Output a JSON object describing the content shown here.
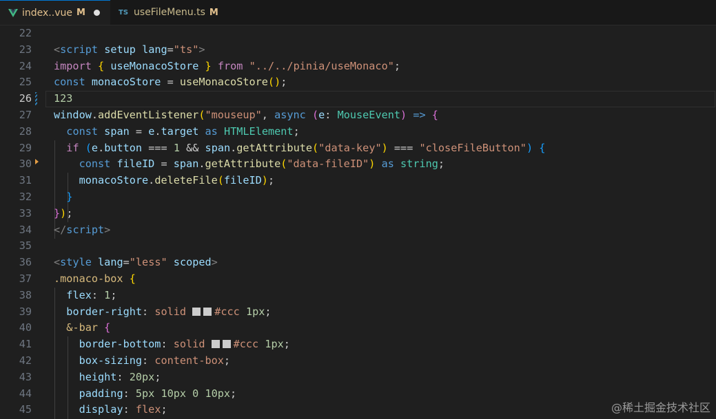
{
  "tabs": [
    {
      "name": "index..vue",
      "status": "M",
      "icon": "vue-icon",
      "dirty": true,
      "active": true
    },
    {
      "name": "useFileMenu.ts",
      "status": "M",
      "icon": "ts-icon",
      "icon_text": "TS",
      "active": false
    }
  ],
  "current_line": 26,
  "lines": [
    {
      "n": "22",
      "tokens": []
    },
    {
      "n": "23",
      "tokens": [
        [
          "tag",
          "<"
        ],
        [
          "tagname",
          "script"
        ],
        [
          "plain",
          " "
        ],
        [
          "attr",
          "setup"
        ],
        [
          "plain",
          " "
        ],
        [
          "attr",
          "lang"
        ],
        [
          "plain",
          "="
        ],
        [
          "str",
          "\"ts\""
        ],
        [
          "tag",
          ">"
        ]
      ]
    },
    {
      "n": "24",
      "tokens": [
        [
          "key",
          "import"
        ],
        [
          "plain",
          " "
        ],
        [
          "br1",
          "{"
        ],
        [
          "plain",
          " "
        ],
        [
          "var",
          "useMonacoStore"
        ],
        [
          "plain",
          " "
        ],
        [
          "br1",
          "}"
        ],
        [
          "plain",
          " "
        ],
        [
          "key",
          "from"
        ],
        [
          "plain",
          " "
        ],
        [
          "str",
          "\"../../pinia/useMonaco\""
        ],
        [
          "plain",
          ";"
        ]
      ]
    },
    {
      "n": "25",
      "tokens": [
        [
          "kw",
          "const"
        ],
        [
          "plain",
          " "
        ],
        [
          "var",
          "monacoStore"
        ],
        [
          "plain",
          " = "
        ],
        [
          "fn",
          "useMonacoStore"
        ],
        [
          "br1",
          "()"
        ],
        [
          "plain",
          ";"
        ]
      ]
    },
    {
      "n": "26",
      "tokens": [
        [
          "num",
          "123"
        ]
      ]
    },
    {
      "n": "27",
      "tokens": [
        [
          "var",
          "window"
        ],
        [
          "plain",
          "."
        ],
        [
          "fn",
          "addEventListener"
        ],
        [
          "br1",
          "("
        ],
        [
          "str",
          "\"mouseup\""
        ],
        [
          "plain",
          ", "
        ],
        [
          "kw",
          "async"
        ],
        [
          "plain",
          " "
        ],
        [
          "br2",
          "("
        ],
        [
          "var",
          "e"
        ],
        [
          "plain",
          ": "
        ],
        [
          "type",
          "MouseEvent"
        ],
        [
          "br2",
          ")"
        ],
        [
          "plain",
          " "
        ],
        [
          "kw",
          "=>"
        ],
        [
          "plain",
          " "
        ],
        [
          "br2",
          "{"
        ]
      ]
    },
    {
      "n": "28",
      "tokens": [
        [
          "plain",
          "  "
        ],
        [
          "kw",
          "const"
        ],
        [
          "plain",
          " "
        ],
        [
          "var",
          "span"
        ],
        [
          "plain",
          " = "
        ],
        [
          "var",
          "e"
        ],
        [
          "plain",
          "."
        ],
        [
          "var",
          "target"
        ],
        [
          "plain",
          " "
        ],
        [
          "kw",
          "as"
        ],
        [
          "plain",
          " "
        ],
        [
          "type",
          "HTMLElement"
        ],
        [
          "plain",
          ";"
        ]
      ]
    },
    {
      "n": "29",
      "tokens": [
        [
          "plain",
          "  "
        ],
        [
          "key",
          "if"
        ],
        [
          "plain",
          " "
        ],
        [
          "br3",
          "("
        ],
        [
          "var",
          "e"
        ],
        [
          "plain",
          "."
        ],
        [
          "var",
          "button"
        ],
        [
          "plain",
          " === "
        ],
        [
          "num",
          "1"
        ],
        [
          "plain",
          " && "
        ],
        [
          "var",
          "span"
        ],
        [
          "plain",
          "."
        ],
        [
          "fn",
          "getAttribute"
        ],
        [
          "br1",
          "("
        ],
        [
          "str",
          "\"data-key\""
        ],
        [
          "br1",
          ")"
        ],
        [
          "plain",
          " === "
        ],
        [
          "str",
          "\"closeFileButton\""
        ],
        [
          "br3",
          ")"
        ],
        [
          "plain",
          " "
        ],
        [
          "br3",
          "{"
        ]
      ]
    },
    {
      "n": "30",
      "tokens": [
        [
          "plain",
          "    "
        ],
        [
          "kw",
          "const"
        ],
        [
          "plain",
          " "
        ],
        [
          "var",
          "fileID"
        ],
        [
          "plain",
          " = "
        ],
        [
          "var",
          "span"
        ],
        [
          "plain",
          "."
        ],
        [
          "fn",
          "getAttribute"
        ],
        [
          "br1",
          "("
        ],
        [
          "str",
          "\"data-fileID\""
        ],
        [
          "br1",
          ")"
        ],
        [
          "plain",
          " "
        ],
        [
          "kw",
          "as"
        ],
        [
          "plain",
          " "
        ],
        [
          "type",
          "string"
        ],
        [
          "plain",
          ";"
        ]
      ]
    },
    {
      "n": "31",
      "tokens": [
        [
          "plain",
          "    "
        ],
        [
          "var",
          "monacoStore"
        ],
        [
          "plain",
          "."
        ],
        [
          "fn",
          "deleteFile"
        ],
        [
          "br1",
          "("
        ],
        [
          "var",
          "fileID"
        ],
        [
          "br1",
          ")"
        ],
        [
          "plain",
          ";"
        ]
      ]
    },
    {
      "n": "32",
      "tokens": [
        [
          "plain",
          "  "
        ],
        [
          "br3",
          "}"
        ]
      ]
    },
    {
      "n": "33",
      "tokens": [
        [
          "br2",
          "}"
        ],
        [
          "br1",
          ")"
        ],
        [
          "plain",
          ";"
        ]
      ]
    },
    {
      "n": "34",
      "tokens": [
        [
          "tag",
          "</"
        ],
        [
          "tagname",
          "script"
        ],
        [
          "tag",
          ">"
        ]
      ]
    },
    {
      "n": "35",
      "tokens": []
    },
    {
      "n": "36",
      "tokens": [
        [
          "tag",
          "<"
        ],
        [
          "tagname",
          "style"
        ],
        [
          "plain",
          " "
        ],
        [
          "attr",
          "lang"
        ],
        [
          "plain",
          "="
        ],
        [
          "str",
          "\"less\""
        ],
        [
          "plain",
          " "
        ],
        [
          "attr",
          "scoped"
        ],
        [
          "tag",
          ">"
        ]
      ]
    },
    {
      "n": "37",
      "tokens": [
        [
          "sel",
          ".monaco-box"
        ],
        [
          "plain",
          " "
        ],
        [
          "br1",
          "{"
        ]
      ]
    },
    {
      "n": "38",
      "tokens": [
        [
          "plain",
          "  "
        ],
        [
          "prop",
          "flex"
        ],
        [
          "plain",
          ": "
        ],
        [
          "num",
          "1"
        ],
        [
          "plain",
          ";"
        ]
      ]
    },
    {
      "n": "39",
      "tokens": [
        [
          "plain",
          "  "
        ],
        [
          "prop",
          "border-right"
        ],
        [
          "plain",
          ": "
        ],
        [
          "val",
          "solid"
        ],
        [
          "plain",
          " "
        ],
        [
          "swatch",
          ""
        ],
        [
          "swatch",
          ""
        ],
        [
          "val",
          "#ccc"
        ],
        [
          "plain",
          " "
        ],
        [
          "num",
          "1px"
        ],
        [
          "plain",
          ";"
        ]
      ]
    },
    {
      "n": "40",
      "tokens": [
        [
          "plain",
          "  "
        ],
        [
          "sel",
          "&-bar"
        ],
        [
          "plain",
          " "
        ],
        [
          "br2",
          "{"
        ]
      ]
    },
    {
      "n": "41",
      "tokens": [
        [
          "plain",
          "    "
        ],
        [
          "prop",
          "border-bottom"
        ],
        [
          "plain",
          ": "
        ],
        [
          "val",
          "solid"
        ],
        [
          "plain",
          " "
        ],
        [
          "swatch",
          ""
        ],
        [
          "swatch",
          ""
        ],
        [
          "val",
          "#ccc"
        ],
        [
          "plain",
          " "
        ],
        [
          "num",
          "1px"
        ],
        [
          "plain",
          ";"
        ]
      ]
    },
    {
      "n": "42",
      "tokens": [
        [
          "plain",
          "    "
        ],
        [
          "prop",
          "box-sizing"
        ],
        [
          "plain",
          ": "
        ],
        [
          "val",
          "content-box"
        ],
        [
          "plain",
          ";"
        ]
      ]
    },
    {
      "n": "43",
      "tokens": [
        [
          "plain",
          "    "
        ],
        [
          "prop",
          "height"
        ],
        [
          "plain",
          ": "
        ],
        [
          "num",
          "20px"
        ],
        [
          "plain",
          ";"
        ]
      ]
    },
    {
      "n": "44",
      "tokens": [
        [
          "plain",
          "    "
        ],
        [
          "prop",
          "padding"
        ],
        [
          "plain",
          ": "
        ],
        [
          "num",
          "5px 10px 0 10px"
        ],
        [
          "plain",
          ";"
        ]
      ]
    },
    {
      "n": "45",
      "tokens": [
        [
          "plain",
          "    "
        ],
        [
          "prop",
          "display"
        ],
        [
          "plain",
          ": "
        ],
        [
          "val",
          "flex"
        ],
        [
          "plain",
          ";"
        ]
      ]
    }
  ],
  "watermark": "@稀土掘金技术社区"
}
